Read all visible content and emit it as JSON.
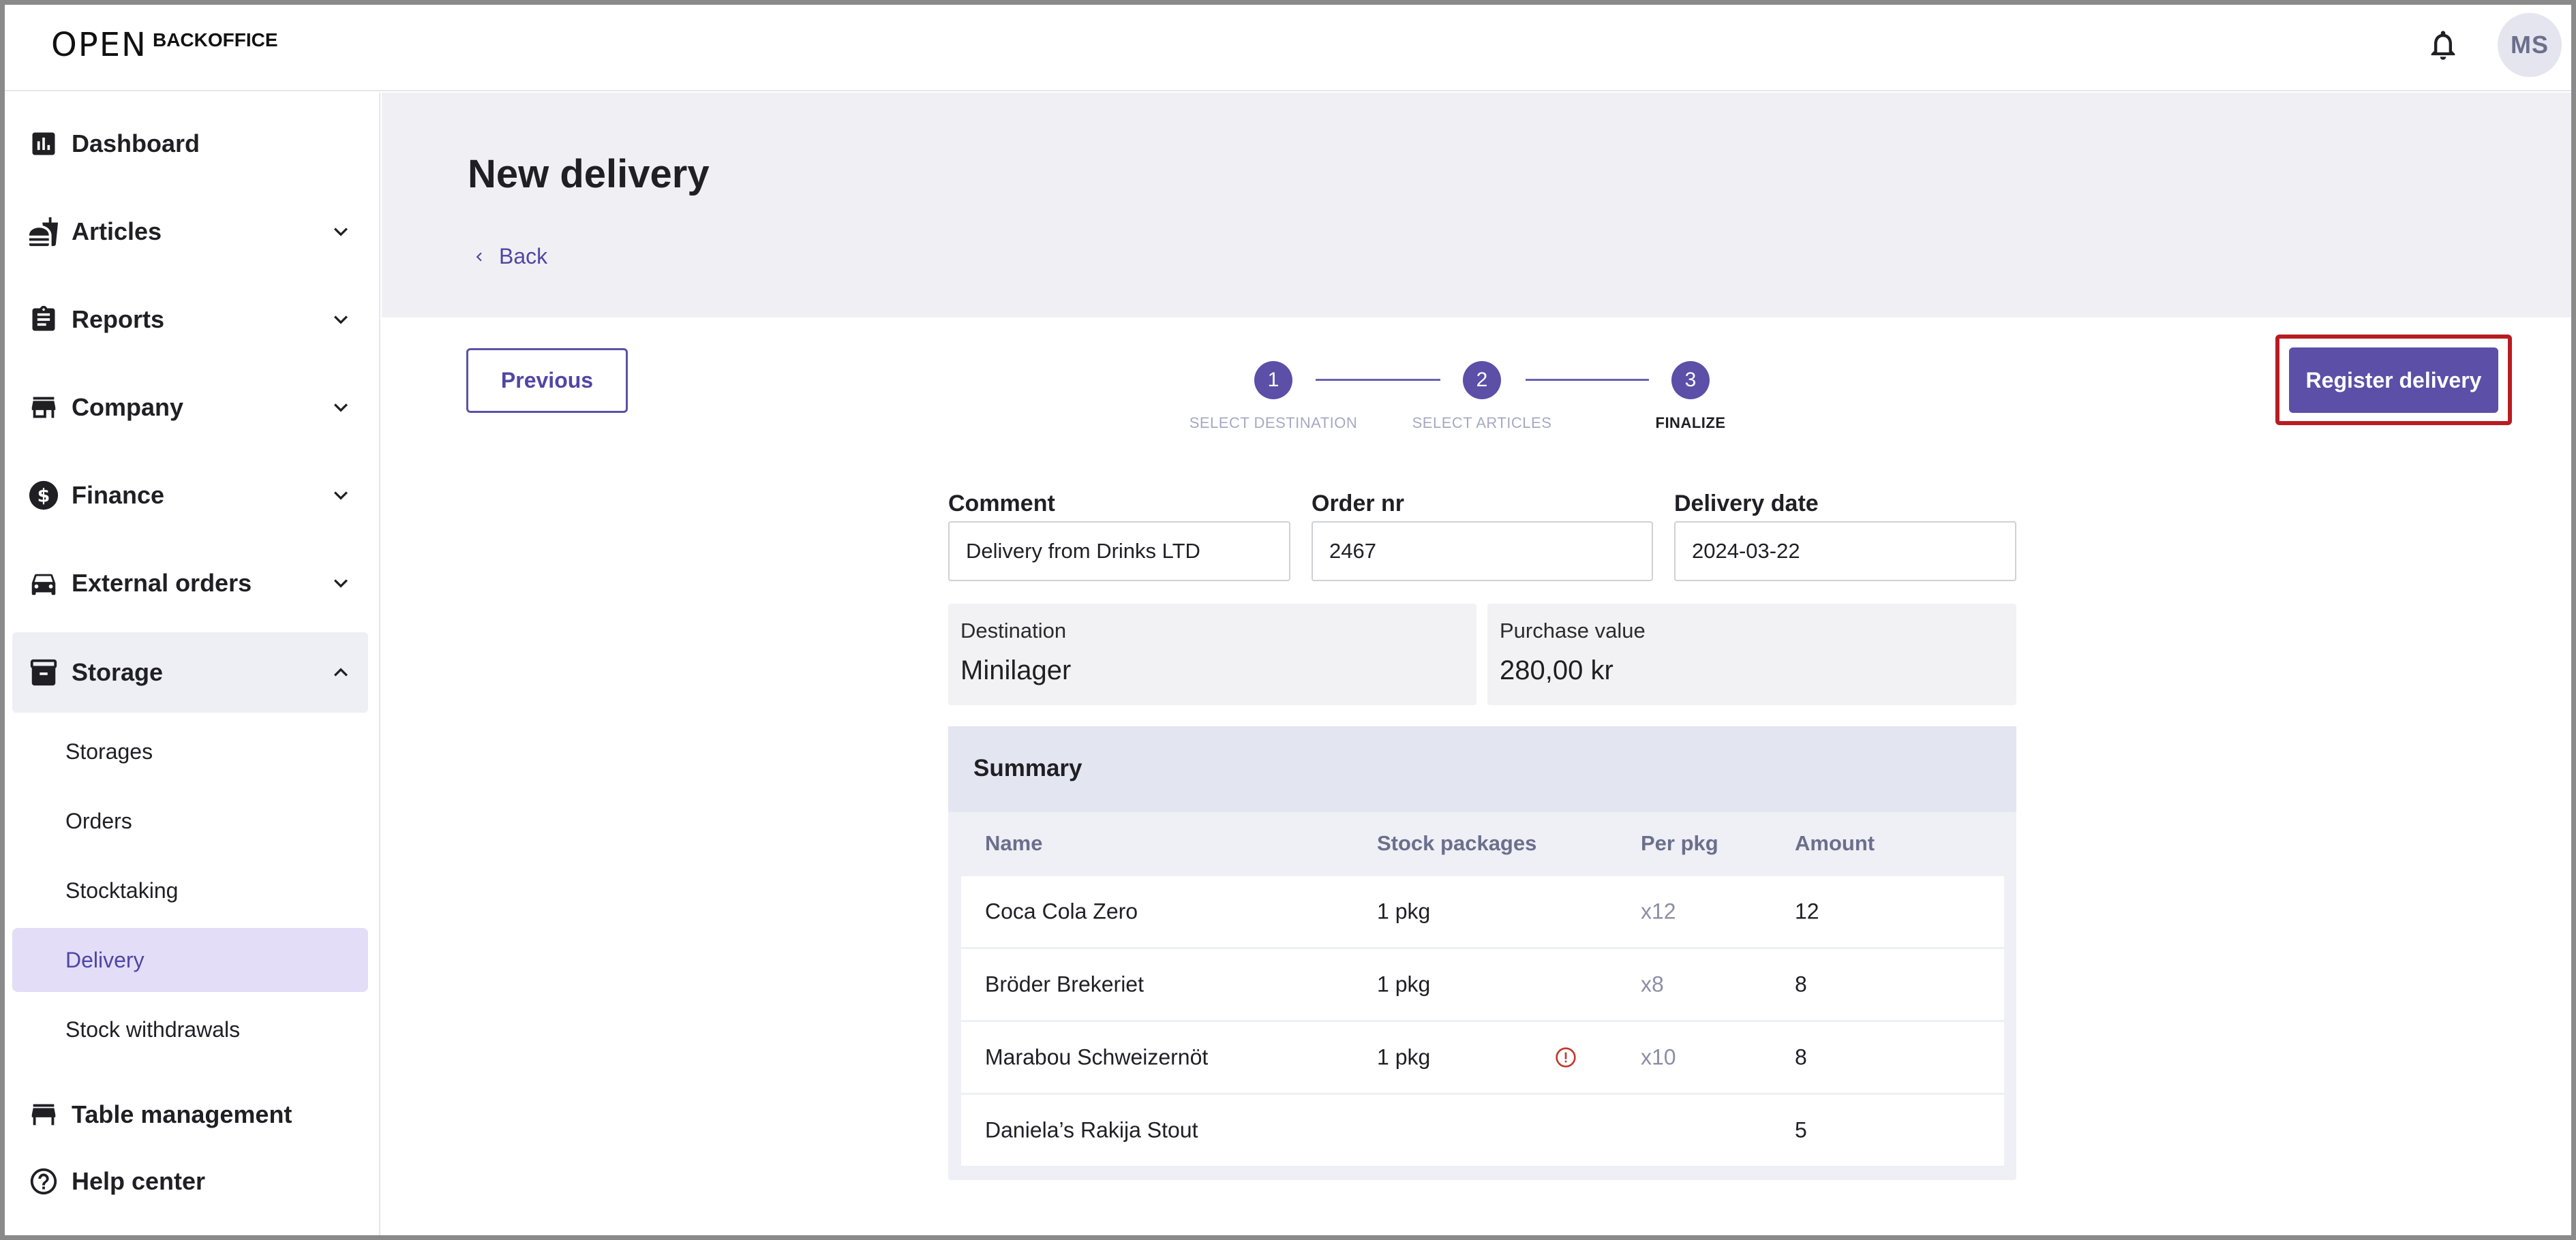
{
  "app": {
    "logo_mark": "OPEN",
    "logo_text": "BACKOFFICE",
    "avatar_initials": "MS"
  },
  "sidebar": {
    "items": [
      {
        "label": "Dashboard",
        "icon": "chart-icon"
      },
      {
        "label": "Articles",
        "icon": "food-icon"
      },
      {
        "label": "Reports",
        "icon": "clipboard-icon"
      },
      {
        "label": "Company",
        "icon": "store-icon"
      },
      {
        "label": "Finance",
        "icon": "dollar-icon"
      },
      {
        "label": "External orders",
        "icon": "car-icon"
      },
      {
        "label": "Storage",
        "icon": "archive-icon"
      },
      {
        "label": "Table management",
        "icon": "table-icon"
      },
      {
        "label": "Help center",
        "icon": "help-icon"
      }
    ],
    "storage_sub": [
      {
        "label": "Storages"
      },
      {
        "label": "Orders"
      },
      {
        "label": "Stocktaking"
      },
      {
        "label": "Delivery"
      },
      {
        "label": "Stock withdrawals"
      }
    ]
  },
  "page": {
    "title": "New delivery",
    "back": "Back"
  },
  "actions": {
    "previous": "Previous",
    "register": "Register delivery"
  },
  "stepper": {
    "steps": [
      {
        "number": "1",
        "label": "SELECT DESTINATION"
      },
      {
        "number": "2",
        "label": "SELECT ARTICLES"
      },
      {
        "number": "3",
        "label": "FINALIZE"
      }
    ],
    "current": 3
  },
  "form": {
    "comment_label": "Comment",
    "comment_value": "Delivery from Drinks LTD",
    "order_label": "Order nr",
    "order_value": "2467",
    "date_label": "Delivery date",
    "date_value": "2024-03-22"
  },
  "info": {
    "destination_label": "Destination",
    "destination_value": "Minilager",
    "purchase_label": "Purchase value",
    "purchase_value": "280,00 kr"
  },
  "summary": {
    "title": "Summary",
    "columns": [
      "Name",
      "Stock packages",
      "Per pkg",
      "Amount"
    ],
    "rows": [
      {
        "name": "Coca Cola Zero",
        "packages": "1 pkg",
        "per_pkg": "x12",
        "amount": "12",
        "warning": false
      },
      {
        "name": "Bröder Brekeriet",
        "packages": "1 pkg",
        "per_pkg": "x8",
        "amount": "8",
        "warning": false
      },
      {
        "name": "Marabou Schweizernöt",
        "packages": "1 pkg",
        "per_pkg": "x10",
        "amount": "8",
        "warning": true
      },
      {
        "name": "Daniela’s Rakija Stout",
        "packages": "",
        "per_pkg": "",
        "amount": "5",
        "warning": false
      }
    ]
  },
  "colors": {
    "accent": "#5b4fa8",
    "highlight": "#b81c22",
    "warning": "#c0392b"
  }
}
